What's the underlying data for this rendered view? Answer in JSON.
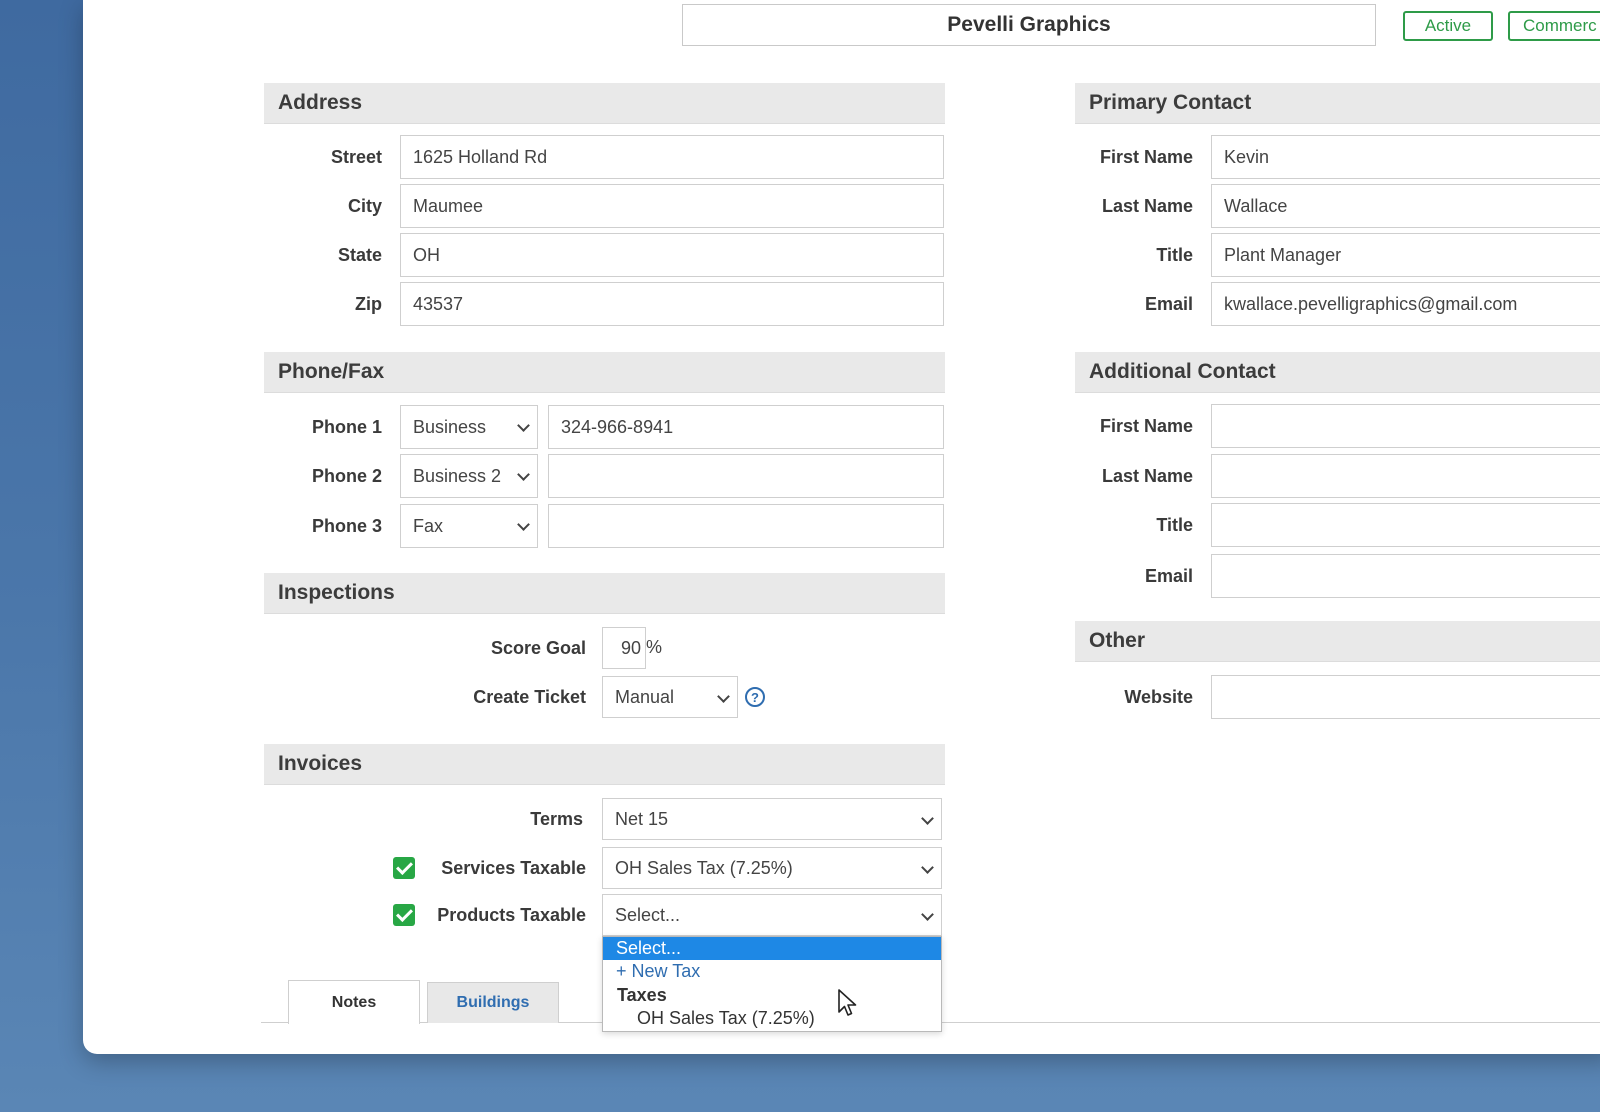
{
  "header": {
    "company_name": "Pevelli Graphics",
    "status_badge": "Active",
    "type_badge": "Commerc"
  },
  "address": {
    "title": "Address",
    "street_label": "Street",
    "street": "1625 Holland Rd",
    "city_label": "City",
    "city": "Maumee",
    "state_label": "State",
    "state": "OH",
    "zip_label": "Zip",
    "zip": "43537"
  },
  "phone_fax": {
    "title": "Phone/Fax",
    "phones": [
      {
        "label": "Phone 1",
        "type": "Business",
        "number": "324-966-8941"
      },
      {
        "label": "Phone 2",
        "type": "Business 2",
        "number": ""
      },
      {
        "label": "Phone 3",
        "type": "Fax",
        "number": ""
      }
    ]
  },
  "inspections": {
    "title": "Inspections",
    "score_goal_label": "Score Goal",
    "score_goal": "90",
    "score_unit": "%",
    "create_ticket_label": "Create Ticket",
    "create_ticket": "Manual",
    "help_icon": "?"
  },
  "invoices": {
    "title": "Invoices",
    "terms_label": "Terms",
    "terms": "Net 15",
    "services_taxable_label": "Services Taxable",
    "services_taxable_checked": true,
    "services_tax": "OH Sales Tax (7.25%)",
    "products_taxable_label": "Products Taxable",
    "products_taxable_checked": true,
    "products_tax": "Select..."
  },
  "products_tax_dropdown": {
    "selected": "Select...",
    "new_tax": "+ New Tax",
    "group": "Taxes",
    "options": [
      "OH Sales Tax (7.25%)"
    ]
  },
  "primary_contact": {
    "title": "Primary Contact",
    "first_name_label": "First Name",
    "first_name": "Kevin",
    "last_name_label": "Last Name",
    "last_name": "Wallace",
    "title_label": "Title",
    "job_title": "Plant Manager",
    "email_label": "Email",
    "email": "kwallace.pevelligraphics@gmail.com"
  },
  "additional_contact": {
    "title": "Additional Contact",
    "first_name_label": "First Name",
    "first_name": "",
    "last_name_label": "Last Name",
    "last_name": "",
    "title_label": "Title",
    "job_title": "",
    "email_label": "Email",
    "email": ""
  },
  "other": {
    "title": "Other",
    "website_label": "Website",
    "website": ""
  },
  "tabs": [
    {
      "label": "Notes",
      "active": true
    },
    {
      "label": "Buildings",
      "active": false
    }
  ],
  "colors": {
    "accent_green": "#2e9b48",
    "checkbox_green": "#28a745",
    "link_blue": "#2f6db0",
    "highlight_blue": "#1e88e5"
  }
}
